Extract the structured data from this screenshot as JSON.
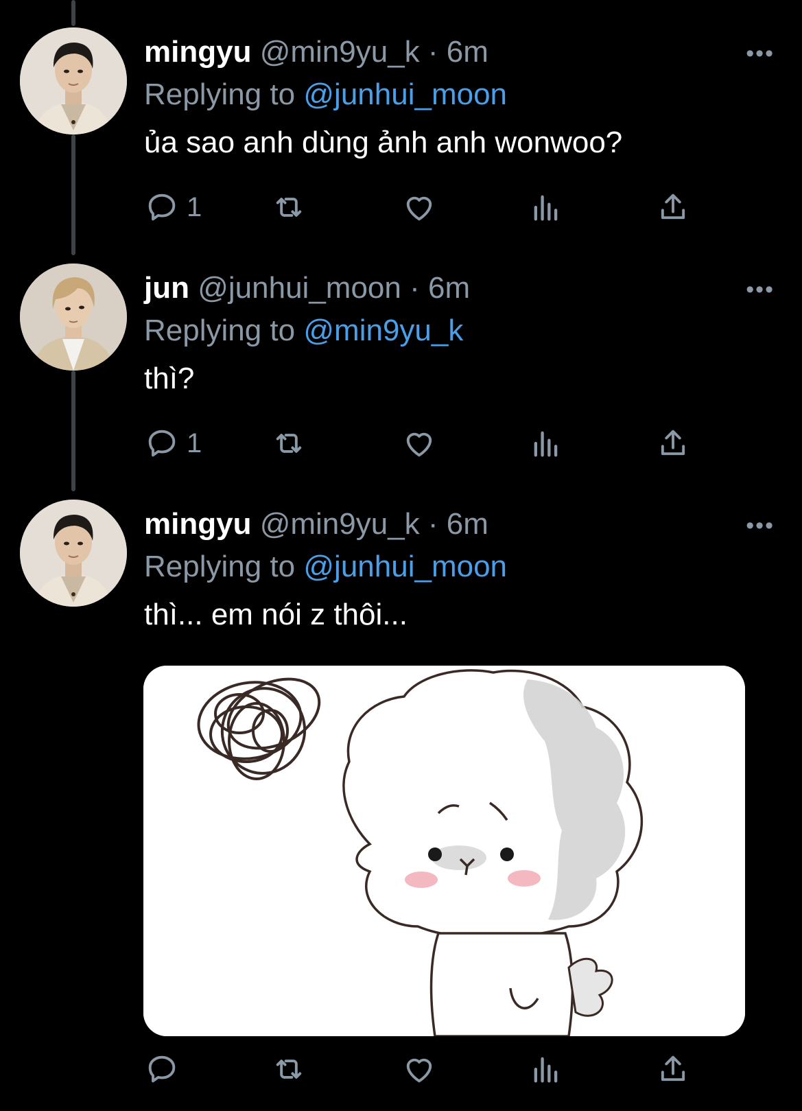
{
  "tweets": [
    {
      "name": "mingyu",
      "handle": "@min9yu_k",
      "dot": "·",
      "time": "6m",
      "replying_prefix": "Replying to",
      "replying_to": "@junhui_moon",
      "text": "ủa sao anh dùng ảnh anh wonwoo?",
      "reply_count": "1",
      "more": "•••"
    },
    {
      "name": "jun",
      "handle": "@junhui_moon",
      "dot": "·",
      "time": "6m",
      "replying_prefix": "Replying to",
      "replying_to": "@min9yu_k",
      "text": "thì?",
      "reply_count": "1",
      "more": "•••"
    },
    {
      "name": "mingyu",
      "handle": "@min9yu_k",
      "dot": "·",
      "time": "6m",
      "replying_prefix": "Replying to",
      "replying_to": "@junhui_moon",
      "text": "thì... em nói z thôi...",
      "reply_count": "",
      "more": "•••",
      "media": "sad-fluffy-dog-sticker"
    }
  ],
  "colors": {
    "background": "#000000",
    "text": "#ffffff",
    "secondary": "#8b98a5",
    "mention": "#4a9fe8",
    "thread_line": "#3d4248"
  },
  "icons": [
    "reply-icon",
    "retweet-icon",
    "like-icon",
    "views-icon",
    "share-icon",
    "more-icon"
  ]
}
